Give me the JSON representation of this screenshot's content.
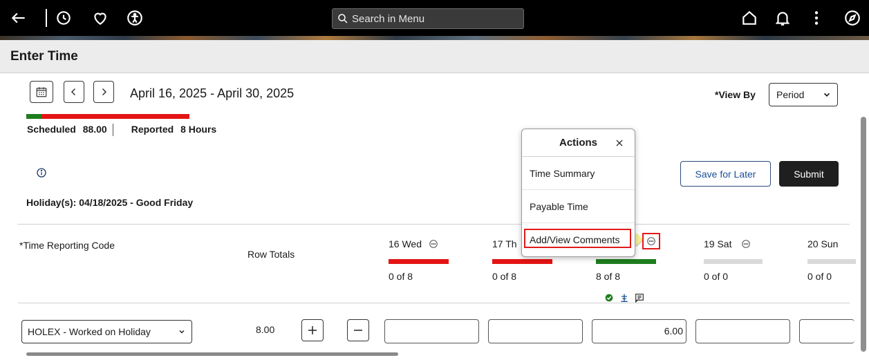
{
  "topbar": {
    "search_placeholder": "Search in Menu"
  },
  "page": {
    "title": "Enter Time"
  },
  "period": {
    "range": "April 16, 2025 - April 30, 2025",
    "scheduled_label": "Scheduled",
    "scheduled_value": "88.00",
    "reported_label": "Reported",
    "reported_value": "8 Hours",
    "holiday": "Holiday(s): 04/18/2025 - Good Friday"
  },
  "view_by": {
    "label": "*View By",
    "selected": "Period"
  },
  "buttons": {
    "save_for_later": "Save for Later",
    "submit": "Submit"
  },
  "grid": {
    "trc_header": "*Time Reporting Code",
    "row_totals_header": "Row Totals",
    "days": [
      {
        "label": "16 Wed",
        "total": "0 of 8",
        "status_color": "#e41414"
      },
      {
        "label": "17 Th",
        "total": "0 of 8",
        "status_color": "#e41414"
      },
      {
        "label": "",
        "total": "8 of 8",
        "status_color": "#1e7d1e"
      },
      {
        "label": "19 Sat",
        "total": "0 of 0",
        "status_color": "#d9d9d9"
      },
      {
        "label": "20 Sun",
        "total": "0 of 0",
        "status_color": "#d9d9d9"
      }
    ],
    "rows": [
      {
        "trc": "HOLEX - Worked on Holiday",
        "row_total": "8.00",
        "values": [
          "",
          "",
          "6.00",
          "",
          ""
        ]
      }
    ]
  },
  "actions_popover": {
    "title": "Actions",
    "items": [
      "Time Summary",
      "Payable Time",
      "Add/View Comments"
    ]
  },
  "colors": {
    "reported_green": "#1e7d1e",
    "unreported_red": "#e41414",
    "highlight_red": "#e11919"
  }
}
